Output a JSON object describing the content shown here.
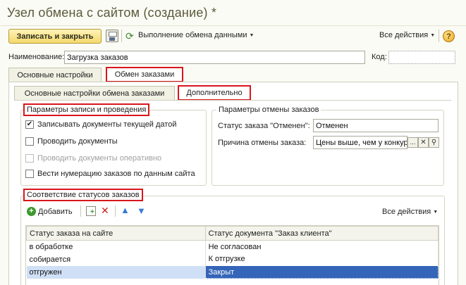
{
  "window": {
    "title": "Узел обмена с сайтом (создание) *"
  },
  "toolbar": {
    "save_close_label": "Записать и закрыть",
    "exchange_label": "Выполнение обмена данными",
    "all_actions_label": "Все действия",
    "help_label": "?"
  },
  "form": {
    "name_label": "Наименование:",
    "name_value": "Загрузка заказов",
    "code_label": "Код:",
    "code_value": ""
  },
  "tabs": [
    {
      "label": "Основные настройки"
    },
    {
      "label": "Обмен заказами"
    }
  ],
  "subtabs": [
    {
      "label": "Основные настройки обмена заказами"
    },
    {
      "label": "Дополнительно"
    }
  ],
  "write_group": {
    "title": "Параметры записи и проведения",
    "options": [
      {
        "label": "Записывать документы текущей датой",
        "checked": true,
        "disabled": false
      },
      {
        "label": "Проводить документы",
        "checked": false,
        "disabled": false
      },
      {
        "label": "Проводить документы оперативно",
        "checked": false,
        "disabled": true
      },
      {
        "label": "Вести нумерацию заказов по данным сайта",
        "checked": false,
        "disabled": false
      }
    ]
  },
  "cancel_group": {
    "title": "Параметры отмены заказов",
    "status_label": "Статус заказа \"Отменен\":",
    "status_value": "Отменен",
    "reason_label": "Причина отмены заказа:",
    "reason_value": "Цены выше, чем у конкур",
    "reason_more": "..."
  },
  "status_group": {
    "title": "Соответствие статусов заказов",
    "add_label": "Добавить",
    "all_actions_label": "Все действия",
    "columns": [
      "Статус заказа на сайте",
      "Статус документа \"Заказ клиента\""
    ],
    "rows": [
      {
        "site": "в обработке",
        "doc": "Не согласован"
      },
      {
        "site": "собирается",
        "doc": "К отгрузке"
      },
      {
        "site": "отгружен",
        "doc": "Закрыт"
      }
    ]
  },
  "colors": {
    "accent_red": "#d9161c",
    "selection": "#3465b8",
    "title_text": "#5a5a3c"
  }
}
